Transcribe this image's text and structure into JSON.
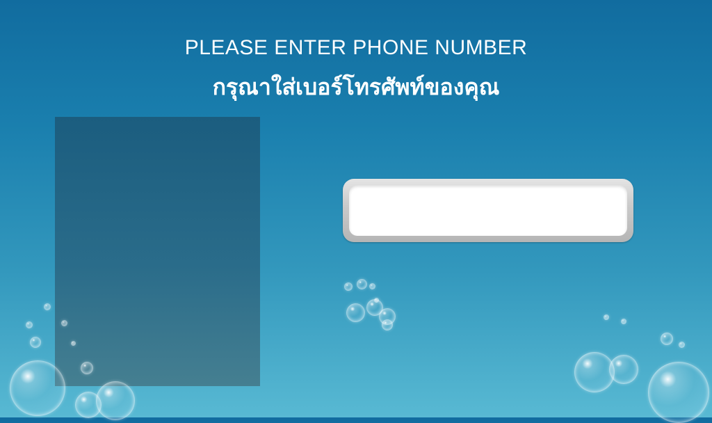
{
  "header": {
    "title_en": "PLEASE ENTER PHONE NUMBER",
    "title_th": "กรุณาใส่เบอร์โทรศัพท์ของคุณ"
  },
  "phone_input": {
    "value": "",
    "placeholder": ""
  },
  "colors": {
    "background_top": "#116c9f",
    "background_bottom": "#58b9d3",
    "panel": "#1f6282",
    "input_frame": "#c9c9c9",
    "text": "#ffffff"
  }
}
